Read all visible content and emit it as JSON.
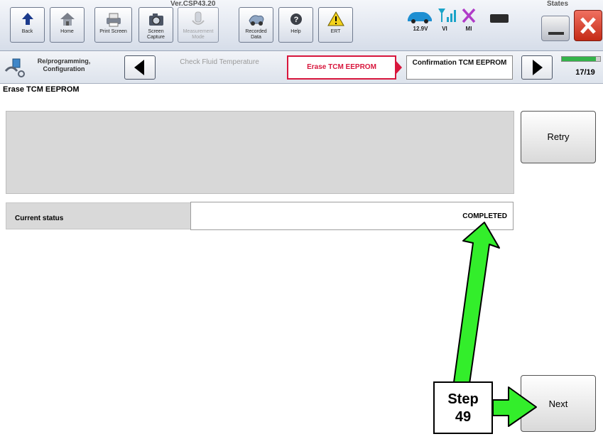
{
  "version_label": "Ver.CSP43.20",
  "states_label": "States",
  "toolbar": {
    "back": "Back",
    "home": "Home",
    "print_screen": "Print Screen",
    "screen_capture": "Screen Capture",
    "measurement_mode": "Measurement Mode",
    "recorded_data": "Recorded Data",
    "help": "Help",
    "ert": "ERT",
    "voltage": "12.9V",
    "vi": "VI",
    "mi": "MI"
  },
  "breadcrumb": {
    "section": "Re/programming, Configuration",
    "prev_step": "Check Fluid Temperature",
    "current_step": "Erase TCM EEPROM",
    "next_step": "Confirmation TCM EEPROM",
    "page_counter": "17/19",
    "progress": 0.895
  },
  "page_title": "Erase TCM EEPROM",
  "buttons": {
    "retry": "Retry",
    "next": "Next"
  },
  "status": {
    "label": "Current status",
    "value": "COMPLETED"
  },
  "annotation": {
    "step_word": "Step",
    "step_number": "49"
  },
  "colors": {
    "highlight_arrow": "#33ee2b",
    "current_step_text": "#d8163c",
    "progress": "#34b34a"
  }
}
